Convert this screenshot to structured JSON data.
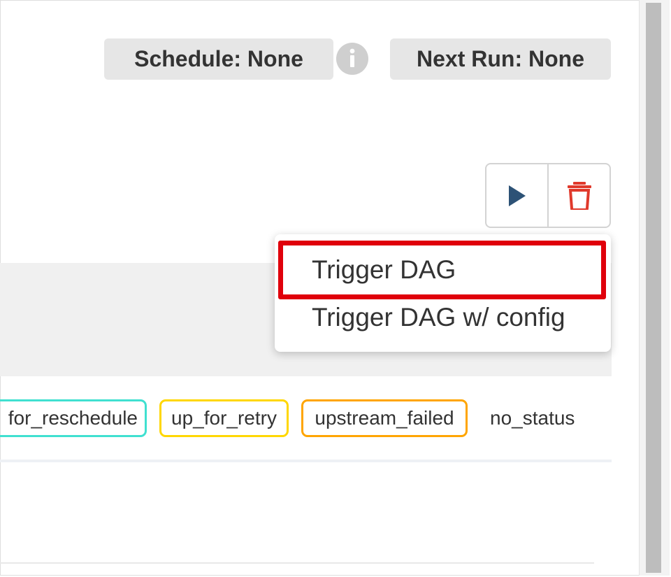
{
  "header": {
    "schedule_label": "Schedule: None",
    "next_run_label": "Next Run: None",
    "info_icon": "info-circle-icon"
  },
  "actions": {
    "trigger_icon": "play-icon",
    "delete_icon": "trash-icon"
  },
  "trigger_menu": {
    "items": [
      {
        "label": "Trigger DAG"
      },
      {
        "label": "Trigger DAG w/ config"
      }
    ],
    "highlight_color": "#e0000b"
  },
  "status_legend": [
    {
      "label": "for_reschedule",
      "color": "#40e0d0"
    },
    {
      "label": "up_for_retry",
      "color": "#ffd700"
    },
    {
      "label": "upstream_failed",
      "color": "#ffa500"
    },
    {
      "label": "no_status",
      "color": ""
    }
  ],
  "colors": {
    "play": "#2d5276",
    "trash": "#e0392b",
    "pill_bg": "#e6e6e6"
  }
}
